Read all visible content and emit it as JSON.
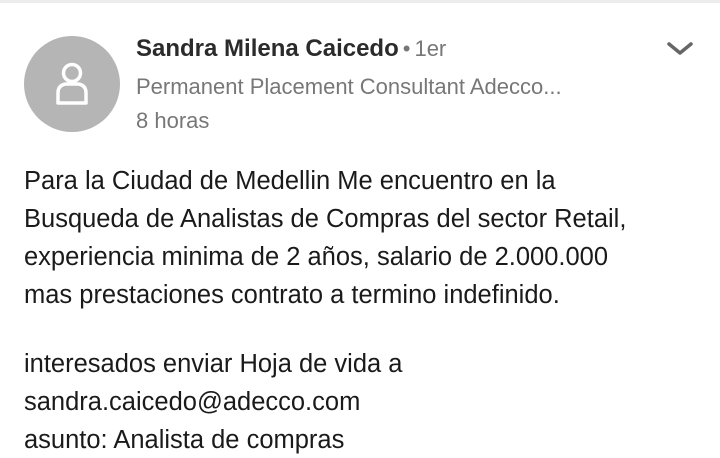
{
  "author": {
    "name": "Sandra Milena Caicedo",
    "separator": "•",
    "degree": "1er",
    "headline": "Permanent Placement Consultant Adecco...",
    "time": "8 horas"
  },
  "icons": {
    "avatar": "person-silhouette-icon",
    "menu": "chevron-down-icon"
  },
  "colors": {
    "avatar_bg": "#b5b5b5",
    "secondary_text": "#777777",
    "primary_text": "#1a1a1a"
  },
  "post": {
    "paragraph1": [
      "Para la Ciudad de Medellin Me encuentro en la",
      "Busqueda de Analistas de Compras del sector Retail,",
      "experiencia minima de 2 años, salario de 2.000.000",
      "mas prestaciones contrato a termino indefinido."
    ],
    "paragraph2": [
      "interesados enviar Hoja de vida a",
      "sandra.caicedo@adecco.com",
      "asunto: Analista de compras"
    ]
  }
}
